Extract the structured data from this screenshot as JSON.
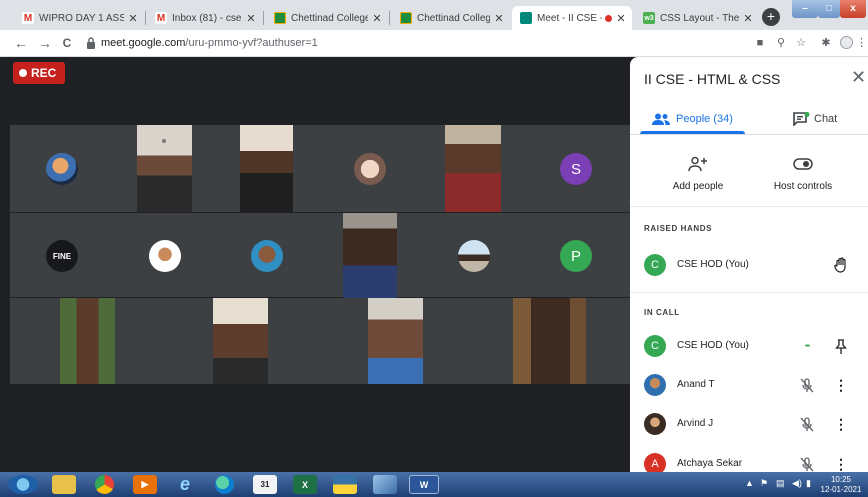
{
  "browser": {
    "tabs": [
      {
        "title": "WIPRO DAY 1 ASSESSM",
        "icon": "gmail-icon",
        "active": false
      },
      {
        "title": "Inbox (81) - csehod@ch",
        "icon": "gmail-icon",
        "active": false
      },
      {
        "title": "Chettinad College of En",
        "icon": "classroom-icon",
        "active": false
      },
      {
        "title": "Chettinad College of En",
        "icon": "classroom-icon",
        "active": false
      },
      {
        "title": "Meet - II CSE - HTM",
        "icon": "meet-icon",
        "active": true,
        "recording": true
      },
      {
        "title": "CSS Layout - The display",
        "icon": "w3schools-icon",
        "active": false
      }
    ],
    "tab_close_glyph": "✕",
    "new_tab_glyph": "+",
    "url_domain": "meet.google.com",
    "url_path": "/uru-pmmo-yvf?authuser=1",
    "nav_back_glyph": "←",
    "nav_forward_glyph": "→",
    "nav_reload_glyph": "C",
    "win_minimize_glyph": "–",
    "win_maximize_glyph": "□",
    "win_close_glyph": "x"
  },
  "meet": {
    "rec_label": "REC",
    "avatar_s_letter": "S",
    "avatar_p_letter": "P",
    "fine_avatar_text": "FINE"
  },
  "panel": {
    "title": "II CSE - HTML & CSS",
    "close_glyph": "✕",
    "people_tab_label": "People (34)",
    "chat_tab_label": "Chat",
    "add_people_label": "Add people",
    "host_controls_label": "Host controls",
    "raised_hands_heading": "RAISED HANDS",
    "in_call_heading": "IN CALL",
    "raised_hands": [
      {
        "name": "CSE HOD (You)",
        "initial": "C"
      }
    ],
    "in_call": [
      {
        "name": "CSE HOD (You)",
        "initial": "C"
      },
      {
        "name": "Anand T",
        "initial": ""
      },
      {
        "name": "Arvind J",
        "initial": ""
      },
      {
        "name": "Atchaya Sekar",
        "initial": "A"
      }
    ],
    "more_dots_glyph": "•••",
    "kebab_glyph": "⋮"
  },
  "taskbar": {
    "time": "10:25",
    "date": "12-01-2021"
  },
  "colors": {
    "meet_dark": "#202124",
    "tile_gray": "#3c4043",
    "accent_blue": "#1a73e8",
    "rec_red": "#c5221f",
    "avatar_green": "#34a853",
    "avatar_purple": "#7b3fb5",
    "avatar_red": "#d93025"
  }
}
